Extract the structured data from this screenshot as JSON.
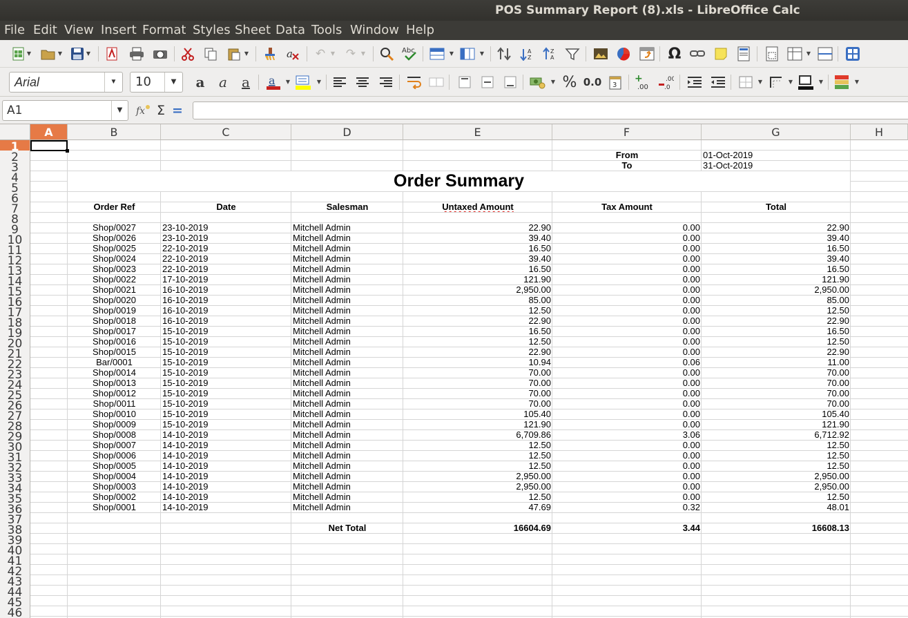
{
  "window": {
    "title": "POS Summary Report (8).xls - LibreOffice Calc"
  },
  "menu": [
    "File",
    "Edit",
    "View",
    "Insert",
    "Format",
    "Styles",
    "Sheet",
    "Data",
    "Tools",
    "Window",
    "Help"
  ],
  "font_bar": {
    "font_name": "Arial",
    "font_size": "10",
    "number_format_decimal": "0.0"
  },
  "formula_bar": {
    "cell_ref": "A1",
    "formula": "",
    "function_wizard_icon": "fx-icon",
    "sum_symbol": "Σ",
    "equals_symbol": "="
  },
  "columns": [
    "A",
    "B",
    "C",
    "D",
    "E",
    "F",
    "G",
    "H"
  ],
  "selected_cell": "A1",
  "sheet": {
    "from_label": "From",
    "from_value": "01-Oct-2019",
    "to_label": "To",
    "to_value": "31-Oct-2019",
    "report_title": "Order Summary",
    "headers": {
      "order_ref": "Order Ref",
      "date": "Date",
      "salesman": "Salesman",
      "untaxed": "Untaxed Amount",
      "tax": "Tax Amount",
      "total": "Total"
    },
    "orders": [
      [
        "Shop/0027",
        "23-10-2019",
        "Mitchell Admin",
        "22.90",
        "0.00",
        "22.90"
      ],
      [
        "Shop/0026",
        "23-10-2019",
        "Mitchell Admin",
        "39.40",
        "0.00",
        "39.40"
      ],
      [
        "Shop/0025",
        "22-10-2019",
        "Mitchell Admin",
        "16.50",
        "0.00",
        "16.50"
      ],
      [
        "Shop/0024",
        "22-10-2019",
        "Mitchell Admin",
        "39.40",
        "0.00",
        "39.40"
      ],
      [
        "Shop/0023",
        "22-10-2019",
        "Mitchell Admin",
        "16.50",
        "0.00",
        "16.50"
      ],
      [
        "Shop/0022",
        "17-10-2019",
        "Mitchell Admin",
        "121.90",
        "0.00",
        "121.90"
      ],
      [
        "Shop/0021",
        "16-10-2019",
        "Mitchell Admin",
        "2,950.00",
        "0.00",
        "2,950.00"
      ],
      [
        "Shop/0020",
        "16-10-2019",
        "Mitchell Admin",
        "85.00",
        "0.00",
        "85.00"
      ],
      [
        "Shop/0019",
        "16-10-2019",
        "Mitchell Admin",
        "12.50",
        "0.00",
        "12.50"
      ],
      [
        "Shop/0018",
        "16-10-2019",
        "Mitchell Admin",
        "22.90",
        "0.00",
        "22.90"
      ],
      [
        "Shop/0017",
        "15-10-2019",
        "Mitchell Admin",
        "16.50",
        "0.00",
        "16.50"
      ],
      [
        "Shop/0016",
        "15-10-2019",
        "Mitchell Admin",
        "12.50",
        "0.00",
        "12.50"
      ],
      [
        "Shop/0015",
        "15-10-2019",
        "Mitchell Admin",
        "22.90",
        "0.00",
        "22.90"
      ],
      [
        "Bar/0001",
        "15-10-2019",
        "Mitchell Admin",
        "10.94",
        "0.06",
        "11.00"
      ],
      [
        "Shop/0014",
        "15-10-2019",
        "Mitchell Admin",
        "70.00",
        "0.00",
        "70.00"
      ],
      [
        "Shop/0013",
        "15-10-2019",
        "Mitchell Admin",
        "70.00",
        "0.00",
        "70.00"
      ],
      [
        "Shop/0012",
        "15-10-2019",
        "Mitchell Admin",
        "70.00",
        "0.00",
        "70.00"
      ],
      [
        "Shop/0011",
        "15-10-2019",
        "Mitchell Admin",
        "70.00",
        "0.00",
        "70.00"
      ],
      [
        "Shop/0010",
        "15-10-2019",
        "Mitchell Admin",
        "105.40",
        "0.00",
        "105.40"
      ],
      [
        "Shop/0009",
        "15-10-2019",
        "Mitchell Admin",
        "121.90",
        "0.00",
        "121.90"
      ],
      [
        "Shop/0008",
        "14-10-2019",
        "Mitchell Admin",
        "6,709.86",
        "3.06",
        "6,712.92"
      ],
      [
        "Shop/0007",
        "14-10-2019",
        "Mitchell Admin",
        "12.50",
        "0.00",
        "12.50"
      ],
      [
        "Shop/0006",
        "14-10-2019",
        "Mitchell Admin",
        "12.50",
        "0.00",
        "12.50"
      ],
      [
        "Shop/0005",
        "14-10-2019",
        "Mitchell Admin",
        "12.50",
        "0.00",
        "12.50"
      ],
      [
        "Shop/0004",
        "14-10-2019",
        "Mitchell Admin",
        "2,950.00",
        "0.00",
        "2,950.00"
      ],
      [
        "Shop/0003",
        "14-10-2019",
        "Mitchell Admin",
        "2,950.00",
        "0.00",
        "2,950.00"
      ],
      [
        "Shop/0002",
        "14-10-2019",
        "Mitchell Admin",
        "12.50",
        "0.00",
        "12.50"
      ],
      [
        "Shop/0001",
        "14-10-2019",
        "Mitchell Admin",
        "47.69",
        "0.32",
        "48.01"
      ]
    ],
    "net_total_label": "Net Total",
    "net_untaxed": "16604.69",
    "net_tax": "3.44",
    "net_total": "16608.13"
  },
  "colors": {
    "titlebar": "#3c3b37",
    "selection_accent": "#e67a46",
    "toolbar_bg": "#efeeed"
  }
}
